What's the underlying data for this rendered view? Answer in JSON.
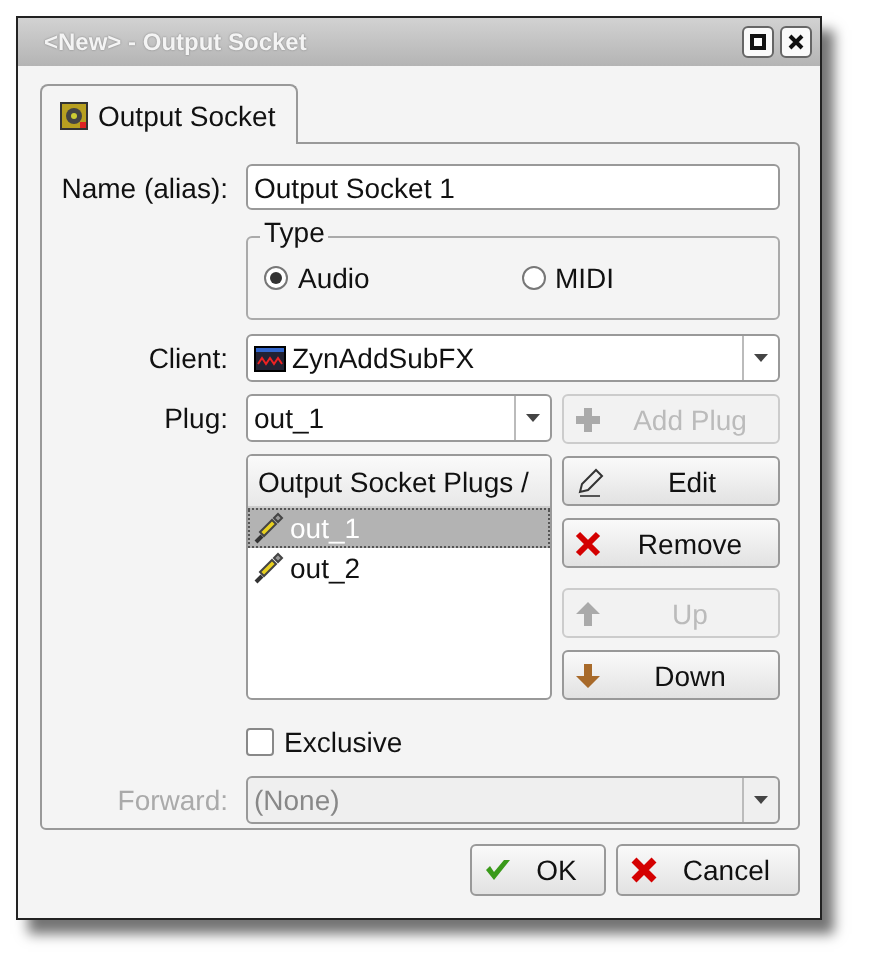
{
  "window": {
    "title": "<New> - Output Socket"
  },
  "tabs": [
    {
      "label": "Output Socket",
      "selected": true
    }
  ],
  "name_field": {
    "label": "Name (alias):",
    "value": "Output Socket 1"
  },
  "type_group": {
    "title": "Type",
    "options": [
      {
        "label": "Audio",
        "selected": true
      },
      {
        "label": "MIDI",
        "selected": false
      }
    ]
  },
  "client": {
    "label": "Client:",
    "value": "ZynAddSubFX"
  },
  "plug": {
    "label": "Plug:",
    "value": "out_1"
  },
  "plug_buttons": [
    {
      "label": "Add Plug",
      "kind": "add",
      "disabled": true
    },
    {
      "label": "Edit",
      "kind": "edit",
      "disabled": false
    },
    {
      "label": "Remove",
      "kind": "remove",
      "disabled": false
    },
    {
      "label": "Up",
      "kind": "up",
      "disabled": true
    },
    {
      "label": "Down",
      "kind": "down",
      "disabled": false
    }
  ],
  "plugs_list": {
    "header": "Output Socket Plugs /",
    "items": [
      {
        "label": "out_1",
        "selected": true
      },
      {
        "label": "out_2",
        "selected": false
      }
    ]
  },
  "exclusive": {
    "label": "Exclusive",
    "checked": false
  },
  "forward": {
    "label": "Forward:",
    "value": "(None)",
    "disabled": true
  },
  "buttons": [
    {
      "label": "OK",
      "kind": "ok"
    },
    {
      "label": "Cancel",
      "kind": "cancel"
    }
  ]
}
